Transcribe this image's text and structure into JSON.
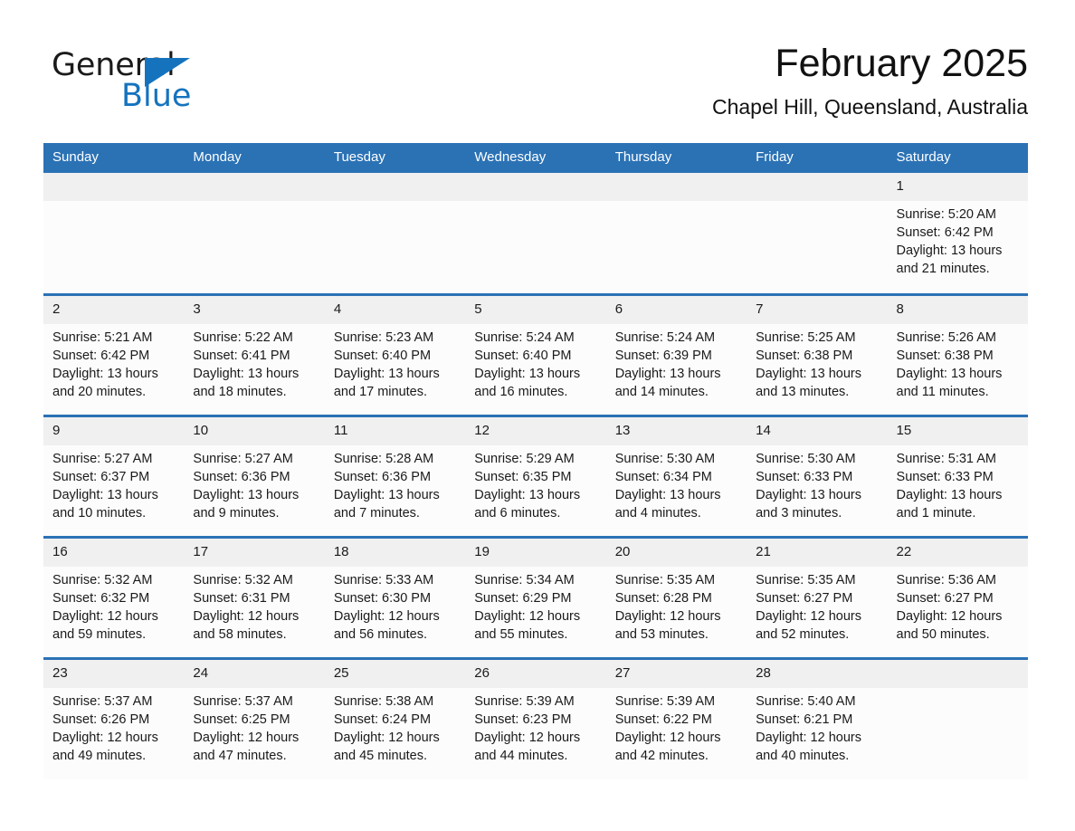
{
  "brand": {
    "name_part1": "General",
    "name_part2": "Blue",
    "logo_icon": "triangle-logo-icon",
    "accent_color": "#1573be"
  },
  "header": {
    "title": "February 2025",
    "subtitle": "Chapel Hill, Queensland, Australia"
  },
  "theme": {
    "header_blue": "#2B72B5",
    "daynum_gray": "#F0F0F0",
    "cell_bg": "#FCFCFC"
  },
  "calendar": {
    "weekday_headers": [
      "Sunday",
      "Monday",
      "Tuesday",
      "Wednesday",
      "Thursday",
      "Friday",
      "Saturday"
    ],
    "weeks": [
      [
        {
          "day": "",
          "sunrise": "",
          "sunset": "",
          "daylight": ""
        },
        {
          "day": "",
          "sunrise": "",
          "sunset": "",
          "daylight": ""
        },
        {
          "day": "",
          "sunrise": "",
          "sunset": "",
          "daylight": ""
        },
        {
          "day": "",
          "sunrise": "",
          "sunset": "",
          "daylight": ""
        },
        {
          "day": "",
          "sunrise": "",
          "sunset": "",
          "daylight": ""
        },
        {
          "day": "",
          "sunrise": "",
          "sunset": "",
          "daylight": ""
        },
        {
          "day": "1",
          "sunrise": "Sunrise: 5:20 AM",
          "sunset": "Sunset: 6:42 PM",
          "daylight": "Daylight: 13 hours and 21 minutes."
        }
      ],
      [
        {
          "day": "2",
          "sunrise": "Sunrise: 5:21 AM",
          "sunset": "Sunset: 6:42 PM",
          "daylight": "Daylight: 13 hours and 20 minutes."
        },
        {
          "day": "3",
          "sunrise": "Sunrise: 5:22 AM",
          "sunset": "Sunset: 6:41 PM",
          "daylight": "Daylight: 13 hours and 18 minutes."
        },
        {
          "day": "4",
          "sunrise": "Sunrise: 5:23 AM",
          "sunset": "Sunset: 6:40 PM",
          "daylight": "Daylight: 13 hours and 17 minutes."
        },
        {
          "day": "5",
          "sunrise": "Sunrise: 5:24 AM",
          "sunset": "Sunset: 6:40 PM",
          "daylight": "Daylight: 13 hours and 16 minutes."
        },
        {
          "day": "6",
          "sunrise": "Sunrise: 5:24 AM",
          "sunset": "Sunset: 6:39 PM",
          "daylight": "Daylight: 13 hours and 14 minutes."
        },
        {
          "day": "7",
          "sunrise": "Sunrise: 5:25 AM",
          "sunset": "Sunset: 6:38 PM",
          "daylight": "Daylight: 13 hours and 13 minutes."
        },
        {
          "day": "8",
          "sunrise": "Sunrise: 5:26 AM",
          "sunset": "Sunset: 6:38 PM",
          "daylight": "Daylight: 13 hours and 11 minutes."
        }
      ],
      [
        {
          "day": "9",
          "sunrise": "Sunrise: 5:27 AM",
          "sunset": "Sunset: 6:37 PM",
          "daylight": "Daylight: 13 hours and 10 minutes."
        },
        {
          "day": "10",
          "sunrise": "Sunrise: 5:27 AM",
          "sunset": "Sunset: 6:36 PM",
          "daylight": "Daylight: 13 hours and 9 minutes."
        },
        {
          "day": "11",
          "sunrise": "Sunrise: 5:28 AM",
          "sunset": "Sunset: 6:36 PM",
          "daylight": "Daylight: 13 hours and 7 minutes."
        },
        {
          "day": "12",
          "sunrise": "Sunrise: 5:29 AM",
          "sunset": "Sunset: 6:35 PM",
          "daylight": "Daylight: 13 hours and 6 minutes."
        },
        {
          "day": "13",
          "sunrise": "Sunrise: 5:30 AM",
          "sunset": "Sunset: 6:34 PM",
          "daylight": "Daylight: 13 hours and 4 minutes."
        },
        {
          "day": "14",
          "sunrise": "Sunrise: 5:30 AM",
          "sunset": "Sunset: 6:33 PM",
          "daylight": "Daylight: 13 hours and 3 minutes."
        },
        {
          "day": "15",
          "sunrise": "Sunrise: 5:31 AM",
          "sunset": "Sunset: 6:33 PM",
          "daylight": "Daylight: 13 hours and 1 minute."
        }
      ],
      [
        {
          "day": "16",
          "sunrise": "Sunrise: 5:32 AM",
          "sunset": "Sunset: 6:32 PM",
          "daylight": "Daylight: 12 hours and 59 minutes."
        },
        {
          "day": "17",
          "sunrise": "Sunrise: 5:32 AM",
          "sunset": "Sunset: 6:31 PM",
          "daylight": "Daylight: 12 hours and 58 minutes."
        },
        {
          "day": "18",
          "sunrise": "Sunrise: 5:33 AM",
          "sunset": "Sunset: 6:30 PM",
          "daylight": "Daylight: 12 hours and 56 minutes."
        },
        {
          "day": "19",
          "sunrise": "Sunrise: 5:34 AM",
          "sunset": "Sunset: 6:29 PM",
          "daylight": "Daylight: 12 hours and 55 minutes."
        },
        {
          "day": "20",
          "sunrise": "Sunrise: 5:35 AM",
          "sunset": "Sunset: 6:28 PM",
          "daylight": "Daylight: 12 hours and 53 minutes."
        },
        {
          "day": "21",
          "sunrise": "Sunrise: 5:35 AM",
          "sunset": "Sunset: 6:27 PM",
          "daylight": "Daylight: 12 hours and 52 minutes."
        },
        {
          "day": "22",
          "sunrise": "Sunrise: 5:36 AM",
          "sunset": "Sunset: 6:27 PM",
          "daylight": "Daylight: 12 hours and 50 minutes."
        }
      ],
      [
        {
          "day": "23",
          "sunrise": "Sunrise: 5:37 AM",
          "sunset": "Sunset: 6:26 PM",
          "daylight": "Daylight: 12 hours and 49 minutes."
        },
        {
          "day": "24",
          "sunrise": "Sunrise: 5:37 AM",
          "sunset": "Sunset: 6:25 PM",
          "daylight": "Daylight: 12 hours and 47 minutes."
        },
        {
          "day": "25",
          "sunrise": "Sunrise: 5:38 AM",
          "sunset": "Sunset: 6:24 PM",
          "daylight": "Daylight: 12 hours and 45 minutes."
        },
        {
          "day": "26",
          "sunrise": "Sunrise: 5:39 AM",
          "sunset": "Sunset: 6:23 PM",
          "daylight": "Daylight: 12 hours and 44 minutes."
        },
        {
          "day": "27",
          "sunrise": "Sunrise: 5:39 AM",
          "sunset": "Sunset: 6:22 PM",
          "daylight": "Daylight: 12 hours and 42 minutes."
        },
        {
          "day": "28",
          "sunrise": "Sunrise: 5:40 AM",
          "sunset": "Sunset: 6:21 PM",
          "daylight": "Daylight: 12 hours and 40 minutes."
        },
        {
          "day": "",
          "sunrise": "",
          "sunset": "",
          "daylight": ""
        }
      ]
    ]
  }
}
